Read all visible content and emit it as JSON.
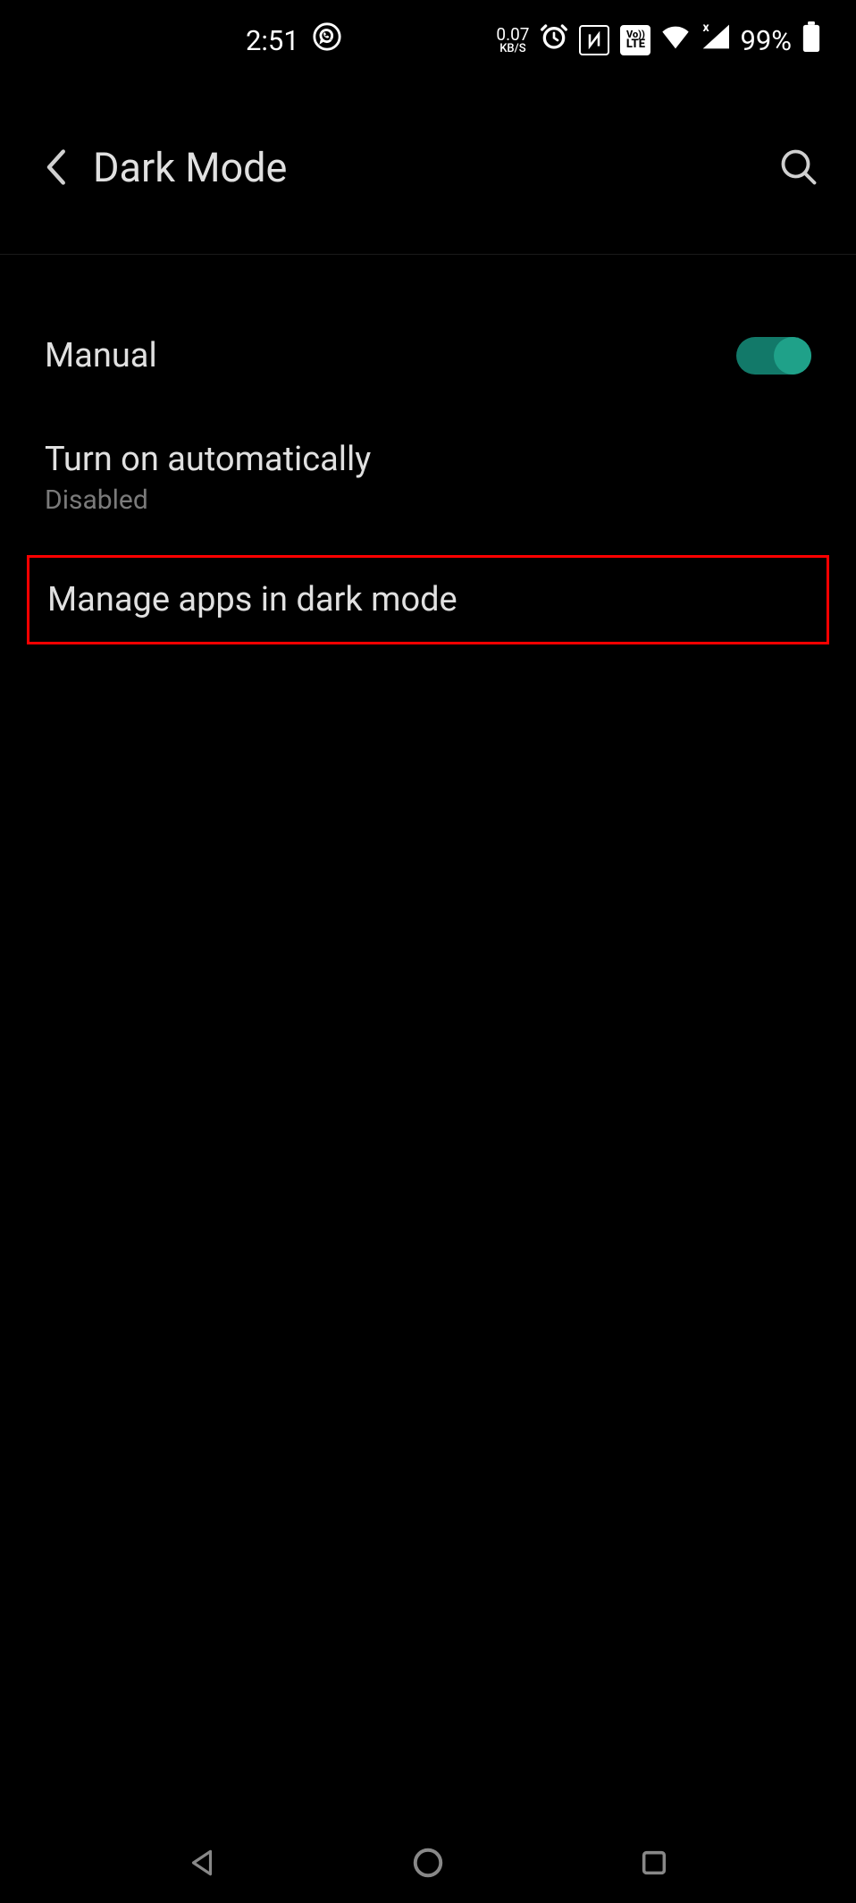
{
  "status_bar": {
    "time": "2:51",
    "net_speed": "0.07",
    "net_unit": "KB/S",
    "battery_pct": "99%"
  },
  "header": {
    "title": "Dark Mode"
  },
  "settings": {
    "manual": {
      "label": "Manual",
      "toggle_on": true
    },
    "auto": {
      "label": "Turn on automatically",
      "sub": "Disabled"
    },
    "manage": {
      "label": "Manage apps in dark mode"
    }
  }
}
